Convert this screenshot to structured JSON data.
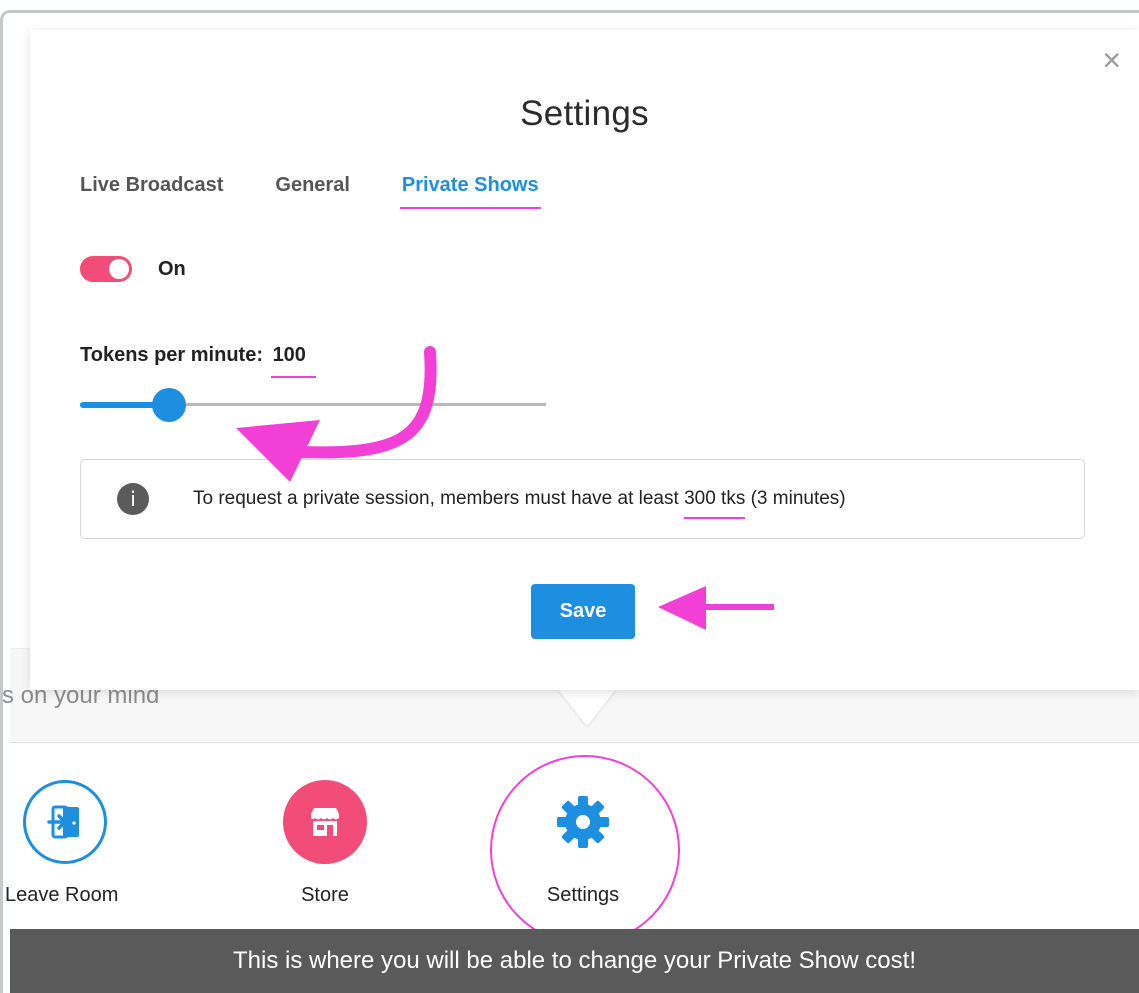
{
  "modal": {
    "title": "Settings",
    "close_glyph": "×",
    "tabs": [
      {
        "label": "Live Broadcast",
        "active": false
      },
      {
        "label": "General",
        "active": false
      },
      {
        "label": "Private Shows",
        "active": true
      }
    ],
    "toggle": {
      "label": "On",
      "state": true
    },
    "tokens": {
      "label": "Tokens per minute:",
      "value": "100",
      "slider_fraction": 0.19
    },
    "info": {
      "icon": "info-icon",
      "icon_glyph": "i",
      "text_before": "To request a private session, members must have at least ",
      "text_emphasis": "300 tks",
      "text_after": " (3 minutes)"
    },
    "save_label": "Save"
  },
  "chat": {
    "placeholder": "s on your mind"
  },
  "toolbar": {
    "items": [
      {
        "label": "Leave Room",
        "icon": "leave-room-icon"
      },
      {
        "label": "Store",
        "icon": "store-icon"
      },
      {
        "label": "Settings",
        "icon": "gear-icon"
      }
    ]
  },
  "tooltip": {
    "text": "This is where you will be able to change your Private Show cost!"
  },
  "colors": {
    "accent_blue": "#1e8fe0",
    "toggle_pink": "#f24c78",
    "annotation_magenta": "#f23fd6",
    "tooltip_bg": "#5a5a5a"
  }
}
